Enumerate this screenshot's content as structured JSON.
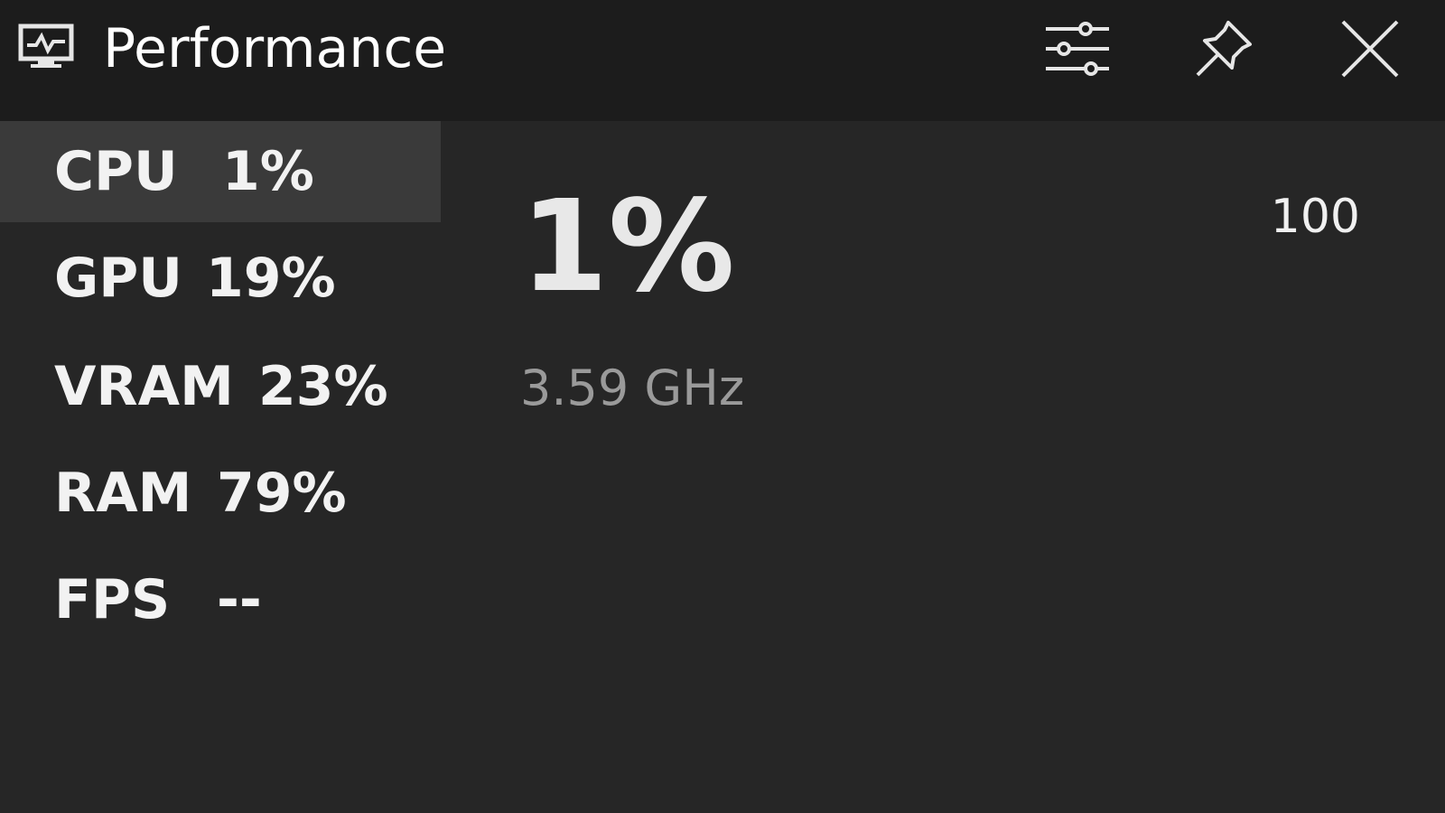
{
  "window": {
    "title": "Performance",
    "app_icon": "monitor-icon",
    "buttons": {
      "settings_icon": "sliders-icon",
      "pin_icon": "pin-icon",
      "close_icon": "close-icon"
    }
  },
  "metrics": [
    {
      "name": "CPU",
      "value": "1%",
      "selected": true
    },
    {
      "name": "GPU",
      "value": "19%",
      "selected": false
    },
    {
      "name": "VRAM",
      "value": "23%",
      "selected": false
    },
    {
      "name": "RAM",
      "value": "79%",
      "selected": false
    },
    {
      "name": "FPS",
      "value": "--",
      "selected": false
    }
  ],
  "detail": {
    "value": "1%",
    "frequency": "3.59 GHz",
    "scale_max": "100"
  },
  "colors": {
    "titlebar": "#1c1c1c",
    "background": "#262626",
    "selected_row": "#3a3a3a",
    "secondary_text": "#9a9a9a"
  }
}
